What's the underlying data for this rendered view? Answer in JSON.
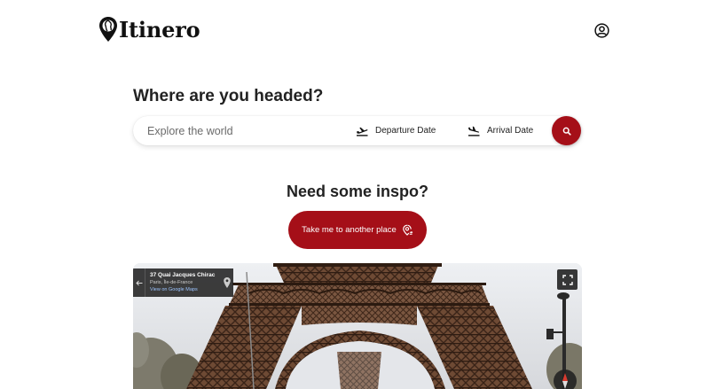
{
  "brand": {
    "name": "Itinero",
    "icon": "map-pin-globe-icon"
  },
  "header": {
    "account_icon": "user-circle-icon"
  },
  "search": {
    "heading": "Where are you headed?",
    "placeholder": "Explore the world",
    "value": "",
    "departure_label": "Departure Date",
    "departure_icon": "plane-departure-icon",
    "arrival_label": "Arrival Date",
    "arrival_icon": "plane-arrival-icon",
    "search_icon": "search-icon"
  },
  "inspo": {
    "heading": "Need some inspo?",
    "button_label": "Take me to another place",
    "button_icon": "location-shuffle-icon"
  },
  "streetview": {
    "address_title": "37 Quai Jacques Chirac",
    "address_subtitle": "Paris, Île-de-France",
    "maps_link": "View on Google Maps",
    "back_icon": "arrow-left-icon",
    "pin_icon": "map-pin-icon",
    "fullscreen_icon": "fullscreen-icon",
    "compass_icon": "compass-icon"
  },
  "colors": {
    "accent": "#a50f18",
    "text": "#222222",
    "overlay": "#222222"
  }
}
